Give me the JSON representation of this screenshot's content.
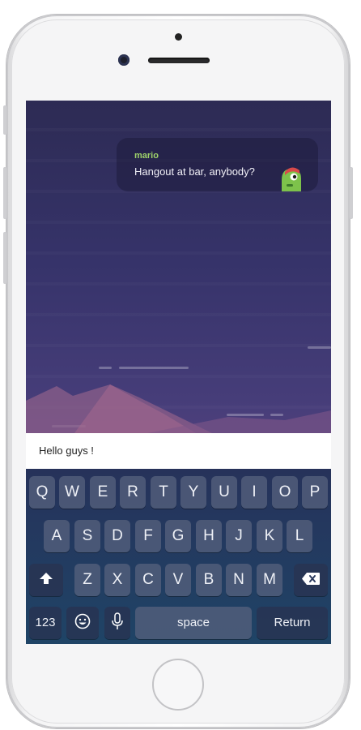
{
  "chat": {
    "message": {
      "sender": "mario",
      "text": "Hangout at bar, anybody?",
      "avatar_icon": "green-dinosaur-avatar"
    }
  },
  "composer": {
    "value": "Hello guys !"
  },
  "keyboard": {
    "row1": [
      "Q",
      "W",
      "E",
      "R",
      "T",
      "Y",
      "U",
      "I",
      "O",
      "P"
    ],
    "row2": [
      "A",
      "S",
      "D",
      "F",
      "G",
      "H",
      "J",
      "K",
      "L"
    ],
    "row3": [
      "Z",
      "X",
      "C",
      "V",
      "B",
      "N",
      "M"
    ],
    "numbers_label": "123",
    "space_label": "space",
    "return_label": "Return",
    "shift_icon": "shift-arrow-icon",
    "delete_icon": "backspace-icon",
    "emoji_icon": "emoji-icon",
    "mic_icon": "microphone-icon"
  },
  "colors": {
    "accent_name": "#9fd36a",
    "sky_top": "#2d2b54",
    "sky_bottom": "#6b4a82"
  }
}
